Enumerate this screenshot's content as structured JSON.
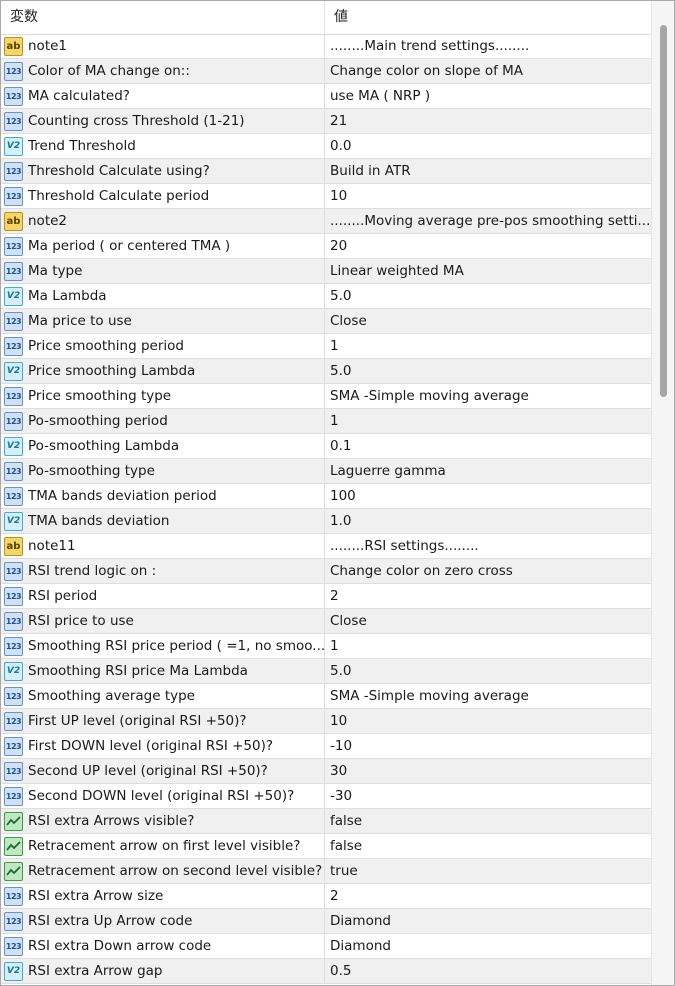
{
  "header": {
    "col_name": "変数",
    "col_value": "値"
  },
  "rows": [
    {
      "icon": "ab",
      "name": "note1",
      "value": "........Main trend  settings........"
    },
    {
      "icon": "123",
      "name": "Color of MA change on::",
      "value": "Change color on slope of MA"
    },
    {
      "icon": "123",
      "name": "MA calculated?",
      "value": "use MA ( NRP )"
    },
    {
      "icon": "123",
      "name": "Counting cross Threshold (1-21)",
      "value": "21"
    },
    {
      "icon": "v2",
      "name": "Trend Threshold",
      "value": "0.0"
    },
    {
      "icon": "123",
      "name": "Threshold Calculate using?",
      "value": "Build in ATR"
    },
    {
      "icon": "123",
      "name": "Threshold Calculate period",
      "value": "10"
    },
    {
      "icon": "ab",
      "name": "note2",
      "value": "........Moving average pre-pos smoothing setti..."
    },
    {
      "icon": "123",
      "name": "Ma period ( or centered TMA )",
      "value": "20"
    },
    {
      "icon": "123",
      "name": "Ma type",
      "value": "Linear weighted MA"
    },
    {
      "icon": "v2",
      "name": "Ma Lambda",
      "value": "5.0"
    },
    {
      "icon": "123",
      "name": "Ma price to use",
      "value": "Close"
    },
    {
      "icon": "123",
      "name": "Price smoothing period",
      "value": "1"
    },
    {
      "icon": "v2",
      "name": "Price smoothing Lambda",
      "value": "5.0"
    },
    {
      "icon": "123",
      "name": "Price smoothing type",
      "value": "SMA -Simple moving average"
    },
    {
      "icon": "123",
      "name": "Po-smoothing period",
      "value": "1"
    },
    {
      "icon": "v2",
      "name": "Po-smoothing Lambda",
      "value": "0.1"
    },
    {
      "icon": "123",
      "name": "Po-smoothing type",
      "value": "Laguerre gamma"
    },
    {
      "icon": "123",
      "name": "TMA  bands deviation period",
      "value": "100"
    },
    {
      "icon": "v2",
      "name": "TMA bands deviation",
      "value": "1.0"
    },
    {
      "icon": "ab",
      "name": "note11",
      "value": "........RSI settings........"
    },
    {
      "icon": "123",
      "name": "RSI trend logic on :",
      "value": "Change color on zero cross"
    },
    {
      "icon": "123",
      "name": "RSI period",
      "value": "2"
    },
    {
      "icon": "123",
      "name": "RSI price to use",
      "value": "Close"
    },
    {
      "icon": "123",
      "name": "Smoothing RSI price period ( =1, no smoo...",
      "value": "1"
    },
    {
      "icon": "v2",
      "name": "Smoothing RSI price Ma Lambda",
      "value": "5.0"
    },
    {
      "icon": "123",
      "name": "Smoothing average type",
      "value": "SMA -Simple moving average"
    },
    {
      "icon": "123",
      "name": "First UP level (original RSI +50)?",
      "value": "10"
    },
    {
      "icon": "123",
      "name": "First DOWN level (original RSI +50)?",
      "value": "-10"
    },
    {
      "icon": "123",
      "name": "Second UP level (original RSI +50)?",
      "value": "30"
    },
    {
      "icon": "123",
      "name": "Second DOWN level (original RSI +50)?",
      "value": "-30"
    },
    {
      "icon": "bool",
      "name": "RSI extra Arrows visible?",
      "value": "false"
    },
    {
      "icon": "bool",
      "name": "Retracement arrow on first level visible?",
      "value": "false"
    },
    {
      "icon": "bool",
      "name": "Retracement arrow on second level visible?",
      "value": "true"
    },
    {
      "icon": "123",
      "name": "RSI extra Arrow size",
      "value": "2"
    },
    {
      "icon": "123",
      "name": "RSI extra Up Arrow code",
      "value": "Diamond"
    },
    {
      "icon": "123",
      "name": "RSI extra Down arrow code",
      "value": "Diamond"
    },
    {
      "icon": "v2",
      "name": "RSI extra Arrow gap",
      "value": "0.5"
    }
  ],
  "icon_glyphs": {
    "ab": "ab",
    "123": "123",
    "v2": "V2"
  }
}
